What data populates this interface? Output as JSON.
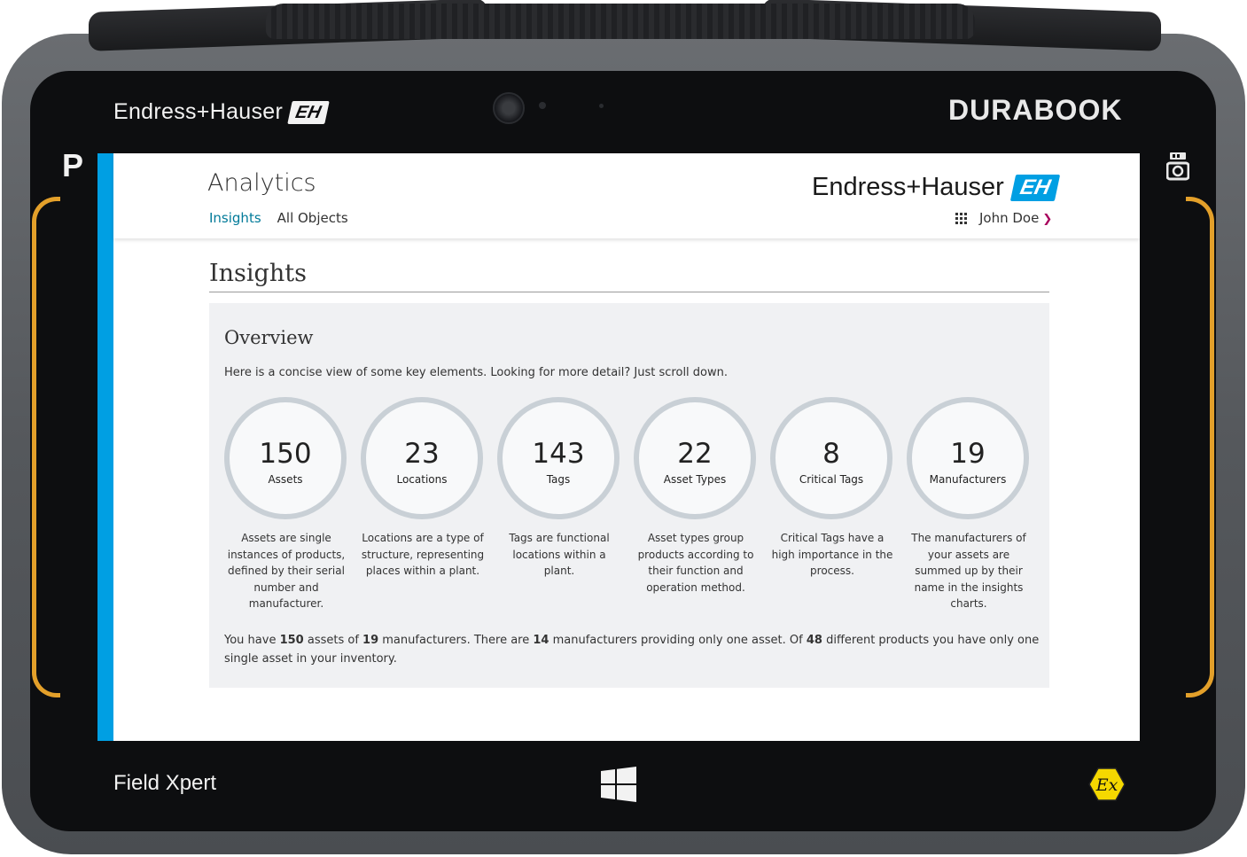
{
  "device": {
    "brand_top": "Endress+Hauser",
    "maker": "DURABOOK",
    "p_key": "P",
    "model": "Field Xpert",
    "eh_mark": "EH",
    "ex_mark": "Ex"
  },
  "header": {
    "title": "Analytics",
    "tabs": [
      {
        "label": "Insights",
        "active": true
      },
      {
        "label": "All Objects",
        "active": false
      }
    ],
    "brand": "Endress+Hauser",
    "brand_mark": "EH",
    "user": "John Doe"
  },
  "page": {
    "heading": "Insights"
  },
  "overview": {
    "title": "Overview",
    "intro": "Here is a concise view of some key elements. Looking for more detail? Just scroll down.",
    "stats": [
      {
        "value": "150",
        "label": "Assets",
        "desc": "Assets are single instances of products, defined by their serial number and manufacturer."
      },
      {
        "value": "23",
        "label": "Locations",
        "desc": "Locations are a type of structure, representing places within a plant."
      },
      {
        "value": "143",
        "label": "Tags",
        "desc": "Tags are functional locations within a plant."
      },
      {
        "value": "22",
        "label": "Asset Types",
        "desc": "Asset types group products according to their function and operation method."
      },
      {
        "value": "8",
        "label": "Critical Tags",
        "desc": "Critical Tags have a high importance in the process."
      },
      {
        "value": "19",
        "label": "Manufacturers",
        "desc": "The manufacturers of your assets are summed up by their name in the insights charts."
      }
    ],
    "summary": {
      "t1": "You have ",
      "assets": "150",
      "t2": " assets of ",
      "manufacturers": "19",
      "t3": " manufacturers. There are ",
      "single_manufacturers": "14",
      "t4": " manufacturers providing only one asset. Of ",
      "products": "48",
      "t5": " different products you have only one single asset in your inventory."
    }
  },
  "colors": {
    "accent": "#009fe3",
    "active_tab": "#007a99",
    "chevron": "#a8005c",
    "ring": "#c9d0d6",
    "panel_bg": "#f0f1f3",
    "bumper_band": "#e3a02a"
  }
}
